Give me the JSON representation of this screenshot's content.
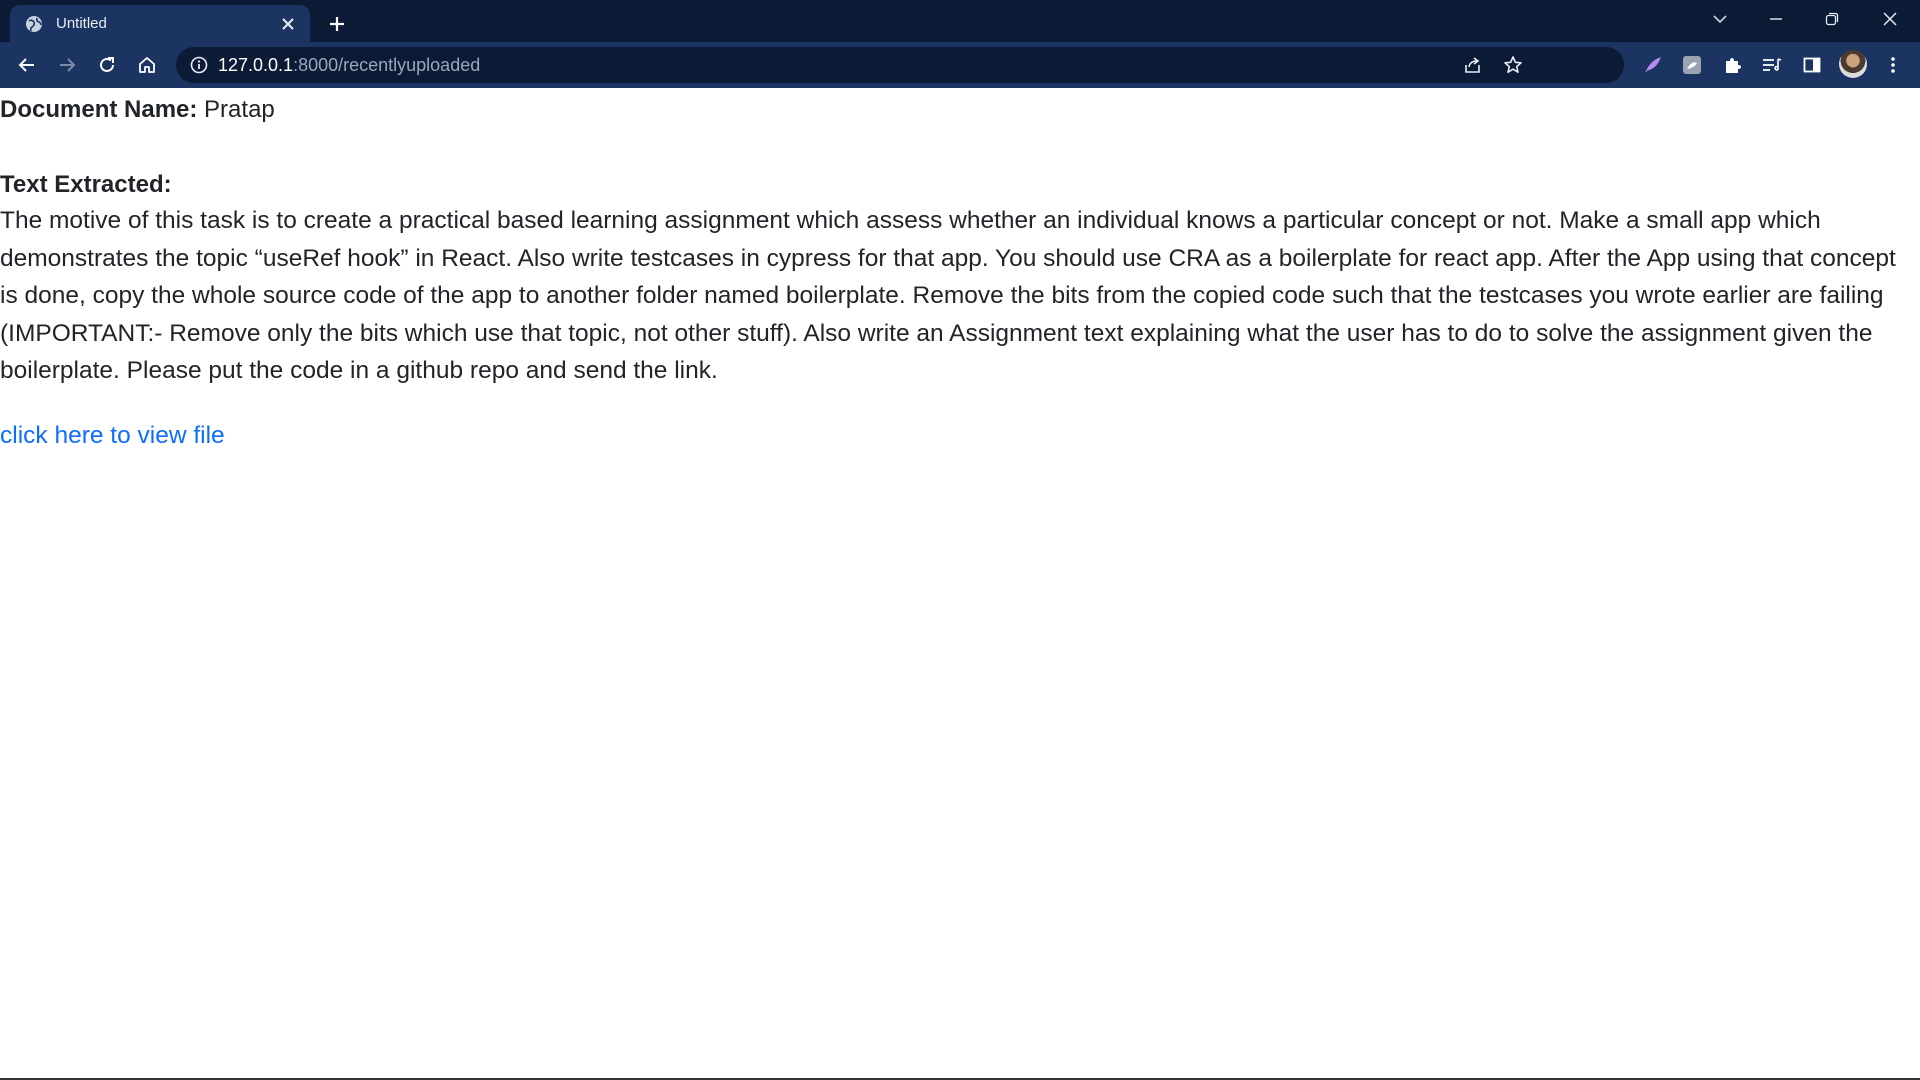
{
  "browser": {
    "tab_title": "Untitled",
    "url_host": "127.0.0.1",
    "url_path": ":8000/recentlyuploaded"
  },
  "document": {
    "name_label": "Document Name:",
    "name_value": "Pratap",
    "text_label": "Text Extracted:",
    "text_value": "The motive of this task is to create a practical based learning assignment which assess whether an individual knows a particular concept or not. Make a small app which demonstrates the topic “useRef hook” in React. Also write testcases in cypress for that app. You should use CRA as a boilerplate for react app. After the App using that concept is done, copy the whole source code of the app to another folder named boilerplate. Remove the bits from the copied code such that the testcases you wrote earlier are failing (IMPORTANT:- Remove only the bits which use that topic, not other stuff). Also write an Assignment text explaining what the user has to do to solve the assignment given the boilerplate. Please put the code in a github repo and send the link.",
    "link_text": "click here to view file"
  },
  "colors": {
    "tabbar_bg": "#0b1a35",
    "toolbar_bg": "#1b3461",
    "link": "#0d6efd",
    "text": "#212529"
  },
  "icons": [
    "globe-icon",
    "close-icon",
    "plus-icon",
    "chevron-down-icon",
    "minimize-icon",
    "restore-icon",
    "window-close-icon",
    "back-icon",
    "forward-icon",
    "reload-icon",
    "home-icon",
    "info-icon",
    "share-icon",
    "star-icon",
    "feather-icon",
    "extension-square-icon",
    "puzzle-icon",
    "reading-list-icon",
    "side-panel-icon",
    "avatar",
    "kebab-menu-icon"
  ]
}
